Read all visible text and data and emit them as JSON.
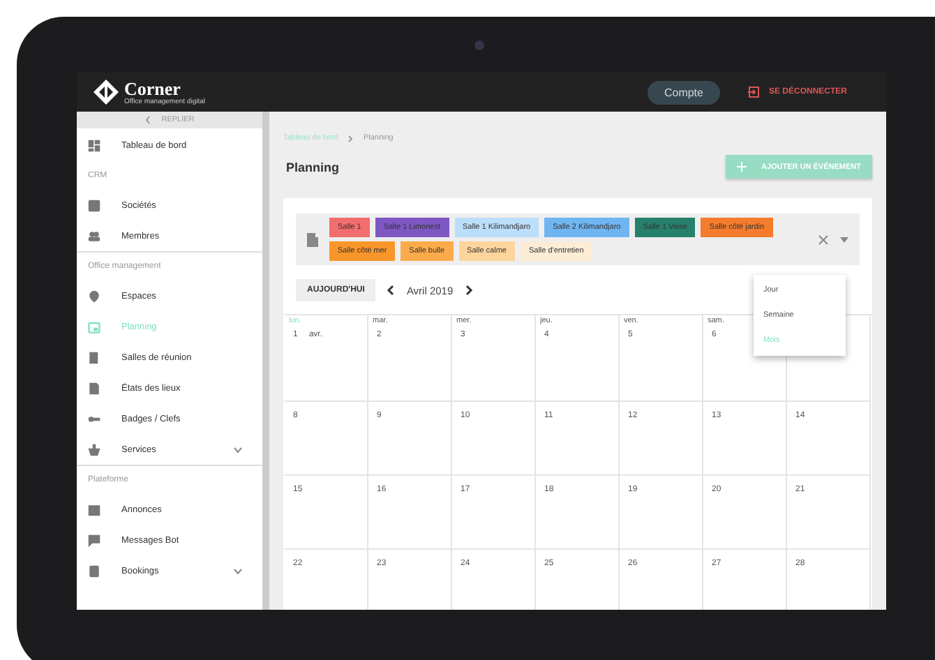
{
  "header": {
    "logo_text": "Corner",
    "logo_tagline": "Office management digital",
    "account_button": "Compte",
    "logout_button": "SE DÉCONNECTER"
  },
  "sidebar": {
    "collapse_label": "REPLIER",
    "sections": [
      {
        "items": [
          {
            "label": "Tableau de bord",
            "selected": false,
            "has_submenu": false
          }
        ]
      },
      {
        "title": "CRM",
        "items": [
          {
            "label": "Sociétés",
            "selected": false,
            "has_submenu": false
          },
          {
            "label": "Membres",
            "selected": false,
            "has_submenu": false
          }
        ]
      },
      {
        "title": "Office management",
        "items": [
          {
            "label": "Espaces",
            "selected": false,
            "has_submenu": false
          },
          {
            "label": "Planning",
            "selected": true,
            "has_submenu": false
          },
          {
            "label": "Salles de réunion",
            "selected": false,
            "has_submenu": false
          },
          {
            "label": "États des lieux",
            "selected": false,
            "has_submenu": false
          },
          {
            "label": "Badges / Clefs",
            "selected": false,
            "has_submenu": false
          },
          {
            "label": "Services",
            "selected": false,
            "has_submenu": true
          }
        ]
      },
      {
        "title": "Plateforme",
        "items": [
          {
            "label": "Annonces",
            "selected": false,
            "has_submenu": false
          },
          {
            "label": "Messages Bot",
            "selected": false,
            "has_submenu": false
          },
          {
            "label": "Bookings",
            "selected": false,
            "has_submenu": true
          }
        ]
      }
    ]
  },
  "breadcrumb": [
    "Tableau de bord",
    "Planning"
  ],
  "page_title": "Planning",
  "add_button": "AJOUTER UN ÉVÉNEMENT",
  "room_filter": [
    {
      "label": "Salle 1",
      "color": "#f26d6d"
    },
    {
      "label": "Salle 1 Limonest",
      "color": "#7e57c2"
    },
    {
      "label": "Salle 1 Kilimandjaro",
      "color": "#bbdefb"
    },
    {
      "label": "Salle 2 Kilimandjaro",
      "color": "#6fb5f2"
    },
    {
      "label": "Salle 1 Vaise",
      "color": "#27806c"
    },
    {
      "label": "Salle côté jardin",
      "color": "#f57c2c"
    },
    {
      "label": "Salle côté mer",
      "color": "#f9962a"
    },
    {
      "label": "Salle bulle",
      "color": "#fbab4c"
    },
    {
      "label": "Salle calme",
      "color": "#fdd59c"
    },
    {
      "label": "Salle d'entretien",
      "color": "#fdecd6"
    }
  ],
  "toolbar": {
    "today_button": "AUJOURD'HUI",
    "month_label": "Avril 2019"
  },
  "view_menu": [
    {
      "label": "Jour",
      "selected": false
    },
    {
      "label": "Semaine",
      "selected": false
    },
    {
      "label": "Mois",
      "selected": true
    }
  ],
  "calendar": {
    "weekdays": [
      {
        "label": "lun.",
        "selected": true
      },
      {
        "label": "mar.",
        "selected": false
      },
      {
        "label": "mer.",
        "selected": false
      },
      {
        "label": "jeu.",
        "selected": false
      },
      {
        "label": "ven.",
        "selected": false
      },
      {
        "label": "sam.",
        "selected": false
      }
    ],
    "weeks": [
      [
        {
          "day": "1",
          "month": "avr."
        },
        {
          "day": "2"
        },
        {
          "day": "3"
        },
        {
          "day": "4"
        },
        {
          "day": "5"
        },
        {
          "day": "6"
        }
      ],
      [
        {
          "day": "8"
        },
        {
          "day": "9"
        },
        {
          "day": "10"
        },
        {
          "day": "11"
        },
        {
          "day": "12"
        },
        {
          "day": "13"
        },
        {
          "day": "14"
        }
      ],
      [
        {
          "day": "15"
        },
        {
          "day": "16"
        },
        {
          "day": "17"
        },
        {
          "day": "18"
        },
        {
          "day": "19"
        },
        {
          "day": "20"
        },
        {
          "day": "21"
        }
      ],
      [
        {
          "day": "22"
        },
        {
          "day": "23"
        },
        {
          "day": "24"
        },
        {
          "day": "25"
        },
        {
          "day": "26"
        },
        {
          "day": "27"
        },
        {
          "day": "28"
        }
      ]
    ]
  }
}
